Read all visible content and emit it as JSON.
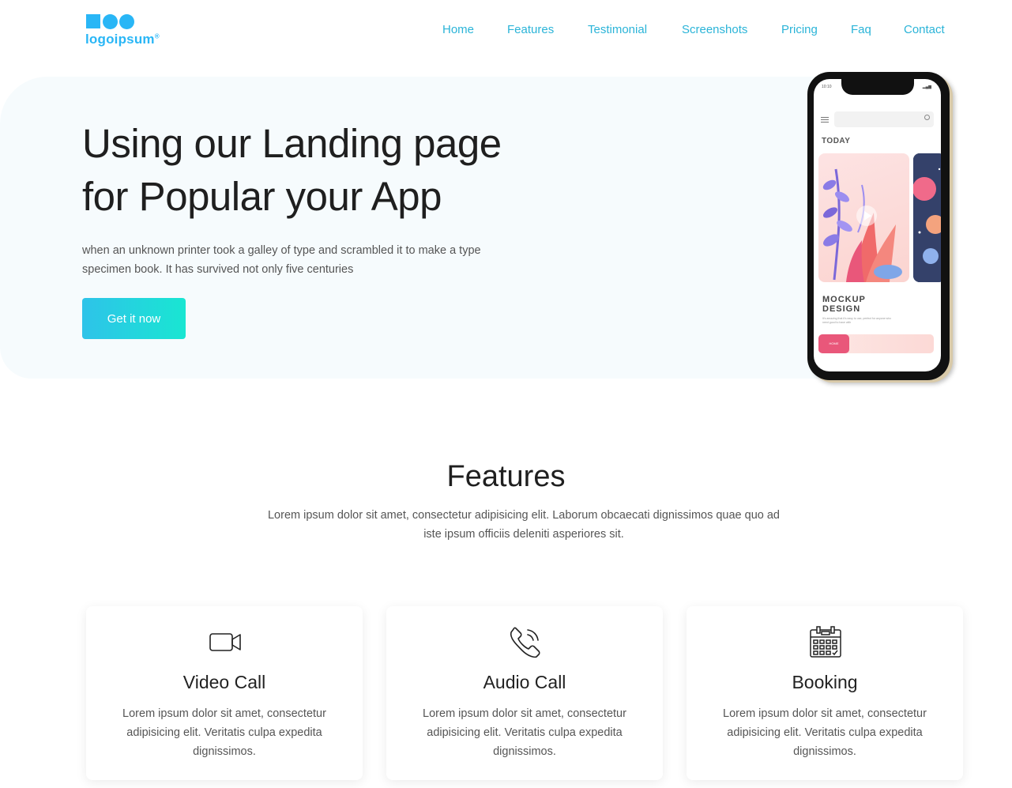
{
  "logo": {
    "text": "logoipsum",
    "mark": "®"
  },
  "nav": {
    "items": [
      {
        "label": "Home"
      },
      {
        "label": "Features"
      },
      {
        "label": "Testimonial"
      },
      {
        "label": "Screenshots"
      },
      {
        "label": "Pricing"
      },
      {
        "label": "Faq"
      },
      {
        "label": "Contact"
      }
    ]
  },
  "hero": {
    "title_line1": "Using our Landing page",
    "title_line2": "for Popular your App",
    "description_line1": "when an unknown printer took a galley of type and scrambled it to make a type",
    "description_line2": "specimen book. It has survived not only five centuries",
    "cta_label": "Get it now"
  },
  "phone_mockup": {
    "time": "10:10",
    "status_icons": "▂▄▆",
    "heading": "TODAY",
    "title_line1": "MOCKUP",
    "title_line2": "DESIGN",
    "small_text": "It's amazing that it's easy to use, perfect for anyone who need good to have with",
    "tab_home": "HOME"
  },
  "features": {
    "title": "Features",
    "description_line1": "Lorem ipsum dolor sit amet, consectetur adipisicing elit. Laborum obcaecati dignissimos quae quo ad",
    "description_line2": "iste ipsum officiis deleniti asperiores sit.",
    "cards": [
      {
        "icon": "video-camera-icon",
        "title": "Video Call",
        "desc_line1": "Lorem ipsum dolor sit amet, consectetur",
        "desc_line2": "adipisicing elit. Veritatis culpa expedita",
        "desc_line3": "dignissimos."
      },
      {
        "icon": "phone-ringing-icon",
        "title": "Audio Call",
        "desc_line1": "Lorem ipsum dolor sit amet, consectetur",
        "desc_line2": "adipisicing elit. Veritatis culpa expedita",
        "desc_line3": "dignissimos."
      },
      {
        "icon": "calendar-icon",
        "title": "Booking",
        "desc_line1": "Lorem ipsum dolor sit amet, consectetur",
        "desc_line2": "adipisicing elit. Veritatis culpa expedita",
        "desc_line3": "dignissimos."
      }
    ]
  },
  "colors": {
    "brand": "#29b6f6",
    "nav_link": "#2bb4d8",
    "cta_gradient_start": "#2ec3e9",
    "cta_gradient_end": "#19e6d2",
    "hero_bg": "#f6fbfd"
  }
}
